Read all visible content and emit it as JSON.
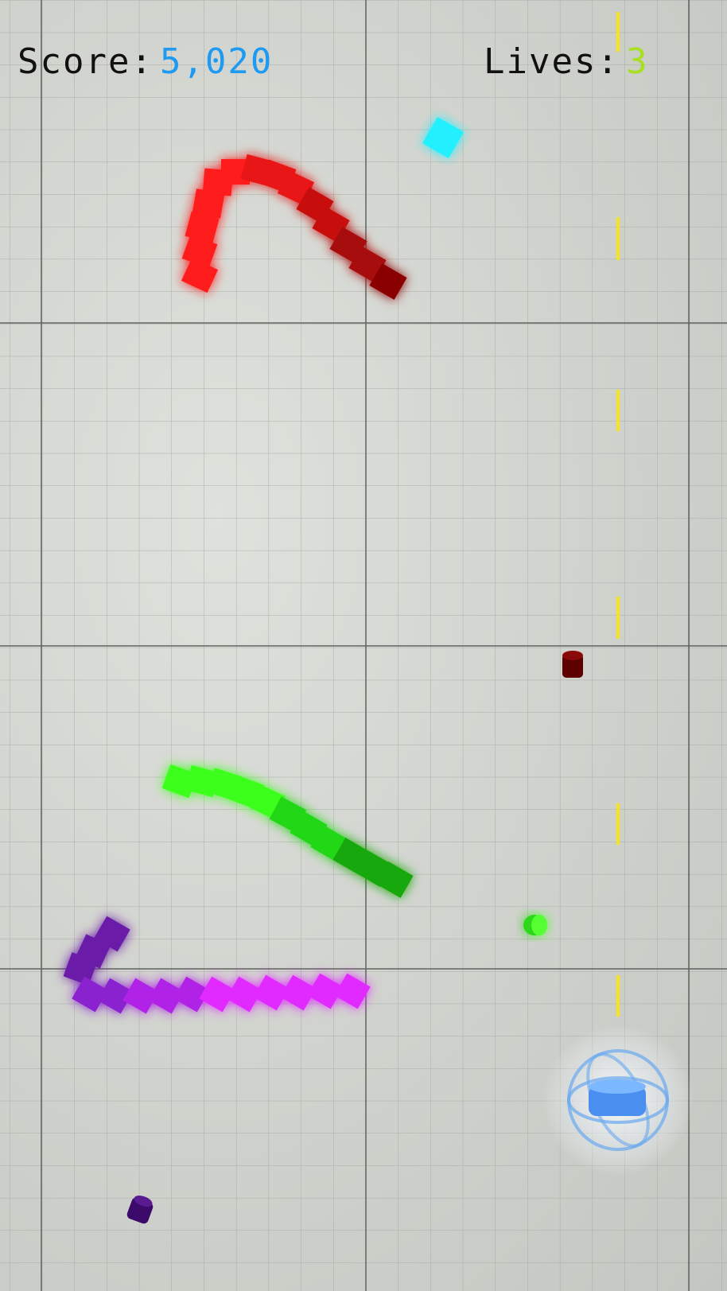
{
  "hud": {
    "score_label": "Score:",
    "score_value": "5,020",
    "lives_label": "Lives:",
    "lives_value": "3"
  },
  "colors": {
    "score": "#1e9bf0",
    "lives": "#a6e01e",
    "lane": "#f5e61a",
    "red_snake": "#ff1a1a",
    "green_snake": "#35ff1a",
    "purple_snake": "#ee22ff",
    "pickup": "#22f0ff",
    "player": "#6aa8f0"
  },
  "icons": [
    "player-orb-icon",
    "cyan-pickup-icon",
    "red-pellet-icon",
    "green-pellet-icon",
    "purple-pellet-icon"
  ]
}
